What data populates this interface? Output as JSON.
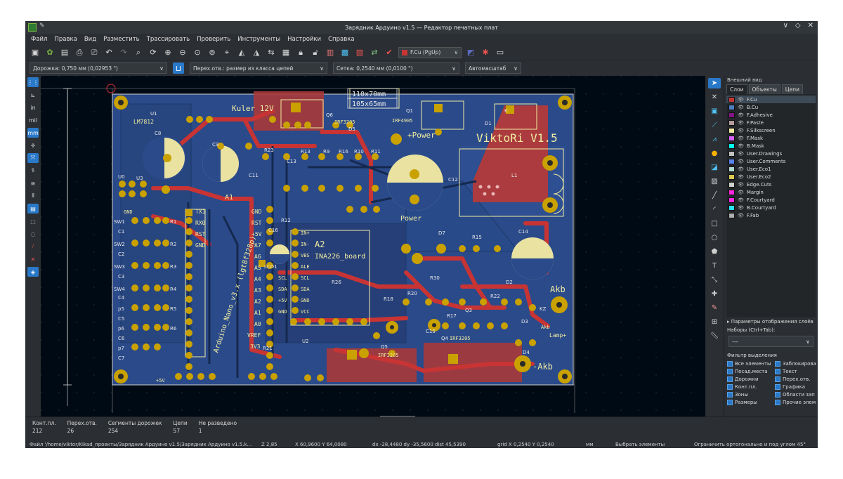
{
  "window": {
    "title": "Зарядник Ардуино v1.5 — Редактор печатных плат",
    "controls": [
      "∨",
      "◇",
      "✕"
    ]
  },
  "menu": [
    "Файл",
    "Правка",
    "Вид",
    "Разместить",
    "Трассировать",
    "Проверить",
    "Инструменты",
    "Настройки",
    "Справка"
  ],
  "toolbar": {
    "layer_selector": "F.Cu (PgUp)"
  },
  "options": {
    "track": "Дорожка: 0,750 мм (0,02953 \")",
    "via": "Перех.отв.: размер из класса цепей",
    "grid": "Сетка: 0,2540 мм (0,0100 \")",
    "zoom": "Автомасштаб"
  },
  "left_toolbar": {
    "inch": "in",
    "mil": "mil",
    "mm": "mm"
  },
  "board": {
    "labels": {
      "dim1": "110x70mm",
      "dim2": "105x65mm",
      "kuler": "Kuler 12V",
      "brand": "ViktoRi V1.5",
      "power_top": "+Power",
      "power_mid": "Power",
      "a1": "A1",
      "a2": "A2",
      "ina": "INA226_board",
      "arduino": "Arduino_Nano_v3.x (lgt8f328p)",
      "akb": "Akb",
      "akb_minus": "-Akb",
      "akb_small": "Akb",
      "lamp": "Lamp+",
      "lm": "LM7812",
      "irf1": "IRF3205",
      "irf2": "IRF4905",
      "irf3": "IRF3205",
      "irf4": "IRF3205",
      "gnd": "GND",
      "plus5v": "+5V",
      "nano_right_pins": [
        "GND",
        "RST",
        "+5V",
        "A7",
        "A6",
        "A5",
        "A4",
        "A3",
        "A2",
        "A1",
        "A0",
        "VREF",
        "3V3"
      ],
      "nano_left_pins": [
        "TX1",
        "RX0",
        "RST",
        "GND"
      ],
      "ina_pins": [
        "IN+",
        "IN-",
        "VBS",
        "ALE",
        "SCL",
        "SDA",
        "GND",
        "VCC"
      ],
      "lcd_pins": [
        "SCL",
        "SDA",
        "+5V",
        "GND"
      ],
      "refs": [
        "U1",
        "C8",
        "Q6",
        "Q1",
        "D1",
        "U0",
        "U3",
        "R1",
        "R2",
        "R3",
        "R4",
        "R5",
        "R6",
        "SW1",
        "SW2",
        "SW3",
        "SW4",
        "C1",
        "C2",
        "C3",
        "C4",
        "p5",
        "p6",
        "p7",
        "C5",
        "C6",
        "C7",
        "C9",
        "C11",
        "C12",
        "C13",
        "C14",
        "C15",
        "C16",
        "R9",
        "R10",
        "R11",
        "R12",
        "R13",
        "R15",
        "R16",
        "R17",
        "R18",
        "R20",
        "R21",
        "R22",
        "R23",
        "R26",
        "R30",
        "D2",
        "D3",
        "D4",
        "D5",
        "D7",
        "Q3",
        "Q4",
        "Q5",
        "U2",
        "L1",
        "LCD1",
        "K",
        "KZ"
      ]
    }
  },
  "appearance": {
    "header": "Внешний вид",
    "tabs": [
      "Слои",
      "Объекты",
      "Цепи"
    ],
    "layers": [
      {
        "name": "F.Cu",
        "color": "#c83434",
        "selected": true
      },
      {
        "name": "B.Cu",
        "color": "#4d7fc4"
      },
      {
        "name": "F.Adhesive",
        "color": "#841584"
      },
      {
        "name": "F.Paste",
        "color": "#b49c9c"
      },
      {
        "name": "F.Silkscreen",
        "color": "#f2eda1"
      },
      {
        "name": "F.Mask",
        "color": "#d864ff"
      },
      {
        "name": "B.Mask",
        "color": "#02ffee"
      },
      {
        "name": "User.Drawings",
        "color": "#c2c2c2"
      },
      {
        "name": "User.Comments",
        "color": "#5984ef"
      },
      {
        "name": "User.Eco1",
        "color": "#b4dbd2"
      },
      {
        "name": "User.Eco2",
        "color": "#d8c852"
      },
      {
        "name": "Edge.Cuts",
        "color": "#d0d2cd"
      },
      {
        "name": "Margin",
        "color": "#ff26e2"
      },
      {
        "name": "F.Courtyard",
        "color": "#ff26e2"
      },
      {
        "name": "B.Courtyard",
        "color": "#26e9ff"
      },
      {
        "name": "F.Fab",
        "color": "#afafaf"
      }
    ],
    "layer_display": "Параметры отображения слоёв",
    "presets_label": "Наборы (Ctrl+Tab):",
    "presets_value": "---",
    "filter_title": "Фильтр выделения",
    "filters": [
      "Все элементы",
      "Заблокирова",
      "Посад.места",
      "Текст",
      "Дорожки",
      "Перех.отв.",
      "Конт.пл.",
      "Графика",
      "Зоны",
      "Области зап",
      "Размеры",
      "Прочие элем"
    ]
  },
  "messages": {
    "stats": [
      {
        "label": "Конт.пл.",
        "value": "212"
      },
      {
        "label": "Перех.отв.",
        "value": "26"
      },
      {
        "label": "Сегменты дорожек",
        "value": "254"
      },
      {
        "label": "Цепи",
        "value": "57"
      },
      {
        "label": "Не разведено",
        "value": "1"
      }
    ]
  },
  "statusbar": {
    "file": "Файл '/home/viktor/Kikad_проекты/Зарядник Ардуино v1.5/Зарядник Ардуино v1.5.k...",
    "zoom": "Z 2,85",
    "xy": "X 60,9600  Y 64,0080",
    "delta": "dx -28,4480  dy -35,5600  dist 45,5390",
    "grid": "grid X 0,2540  Y 0,2540",
    "units": "мм",
    "mode": "Выбрать элементы",
    "constraint": "Ограничить ортогонально и под углом 45°"
  },
  "colors": {
    "board": "#2a4a8a",
    "copper_front": "#c83434",
    "silk": "#f2eda1",
    "pad": "#c9a100",
    "background": "#000a14"
  }
}
